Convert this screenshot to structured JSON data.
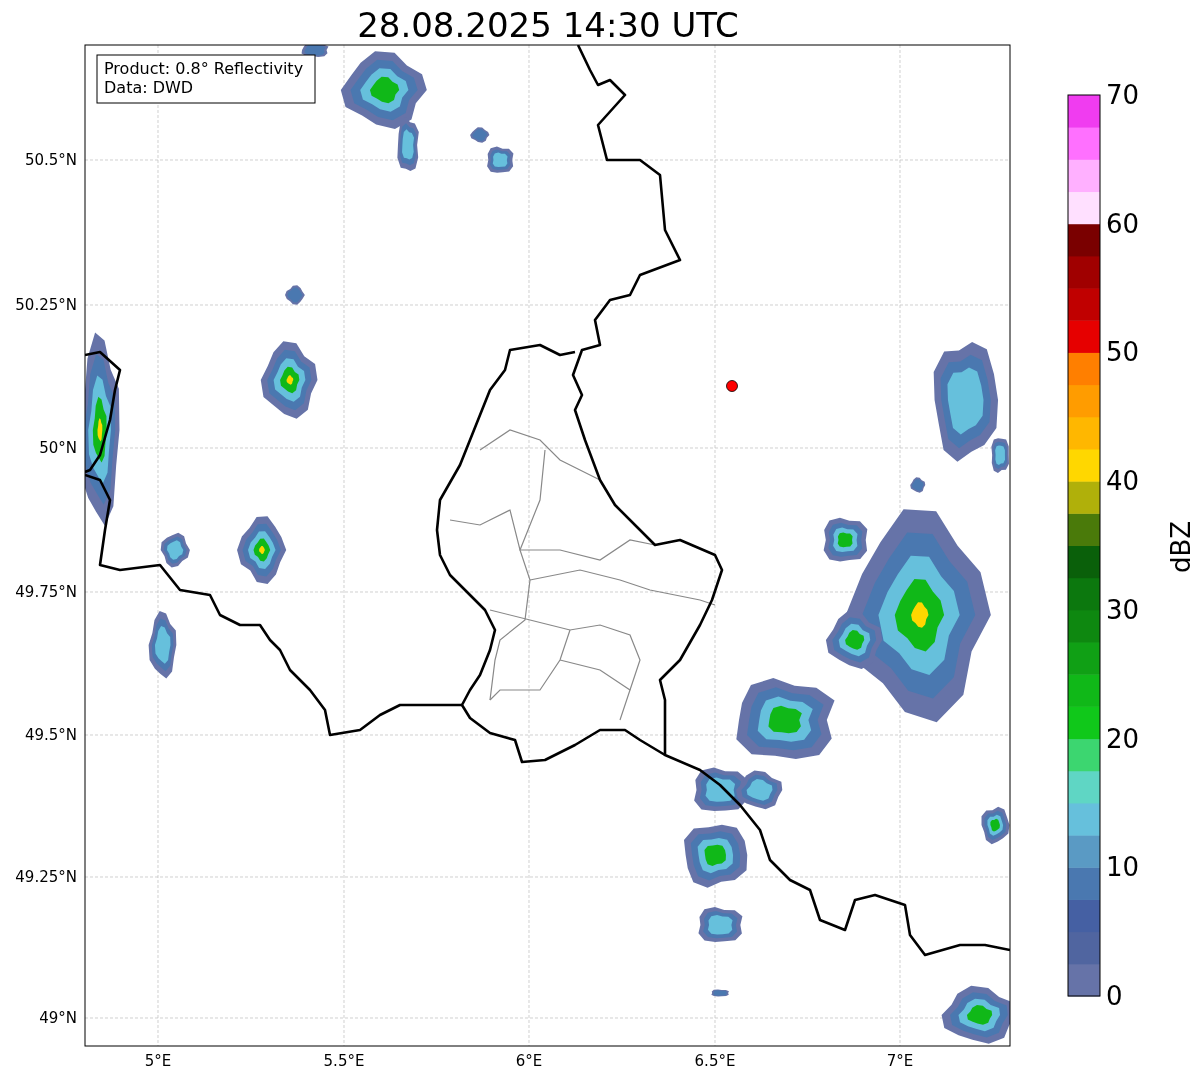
{
  "title": "28.08.2025 14:30 UTC",
  "annotation": {
    "lines": [
      "Product: 0.8° Reflectivity",
      "Data: DWD"
    ]
  },
  "lat_ticks": [
    "50.5°N",
    "50.25°N",
    "50°N",
    "49.75°N",
    "49.5°N",
    "49.25°N",
    "49°N"
  ],
  "lon_ticks": [
    "5°E",
    "5.5°E",
    "6°E",
    "6.5°E",
    "7°E"
  ],
  "colorbar": {
    "label": "dBZ",
    "ticks": [
      "70",
      "60",
      "50",
      "40",
      "30",
      "20",
      "10",
      "0"
    ],
    "bins": [
      {
        "color": "#6673a8"
      },
      {
        "color": "#5065a0"
      },
      {
        "color": "#4560a3"
      },
      {
        "color": "#4a78b0"
      },
      {
        "color": "#5a9ac4"
      },
      {
        "color": "#66c0dc"
      },
      {
        "color": "#5fd6c4"
      },
      {
        "color": "#3cd670"
      },
      {
        "color": "#10c81a"
      },
      {
        "color": "#10b818"
      },
      {
        "color": "#10a015"
      },
      {
        "color": "#0e8810"
      },
      {
        "color": "#0c780e"
      },
      {
        "color": "#0a600a"
      },
      {
        "color": "#4a7a0a"
      },
      {
        "color": "#b0b00a"
      },
      {
        "color": "#ffd700"
      },
      {
        "color": "#ffb700"
      },
      {
        "color": "#ff9c00"
      },
      {
        "color": "#ff7f00"
      },
      {
        "color": "#e60000"
      },
      {
        "color": "#c00000"
      },
      {
        "color": "#a00000"
      },
      {
        "color": "#7a0000"
      },
      {
        "color": "#ffe0ff"
      },
      {
        "color": "#ffb0ff"
      },
      {
        "color": "#ff70ff"
      },
      {
        "color": "#f03cf0"
      }
    ]
  }
}
